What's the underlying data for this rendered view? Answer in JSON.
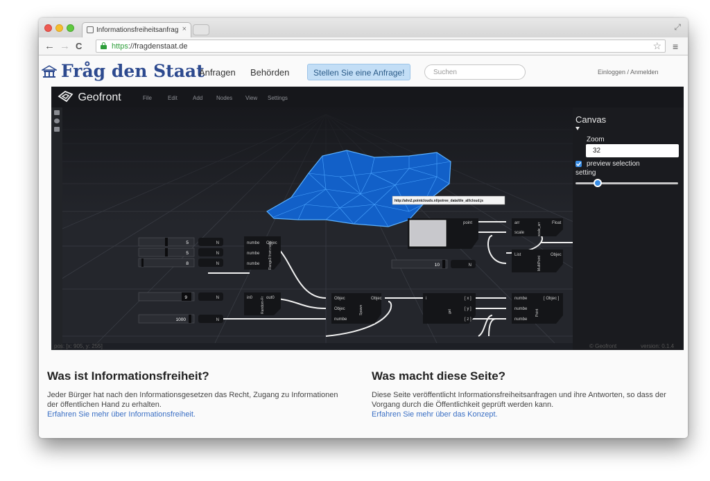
{
  "browser": {
    "tab_title": "Informationsfreiheitsanfrag",
    "tab_close": "×",
    "url_https": "https",
    "url_rest": "://fragdenstaat.de",
    "back": "←",
    "forward": "→",
    "reload": "C",
    "star": "☆",
    "menu": "≡",
    "expand": "⤢"
  },
  "site": {
    "logo": "Fråg den Staat",
    "nav": [
      "Anfragen",
      "Behörden"
    ],
    "cta": "Stellen Sie eine Anfrage!",
    "search_placeholder": "Suchen",
    "login": "Einloggen / Anmelden"
  },
  "app": {
    "name": "Geofront",
    "menu": [
      "File",
      "Edit",
      "Add",
      "Nodes",
      "View",
      "Settings"
    ],
    "tooltip": "http://ahn2.pointclouds.nl/potree_data/tile_all/cloud.js",
    "status_left": "pos: [x: 905, y: 255]",
    "status_right_1": "© Geofront",
    "status_right_2": "version: 0.1.4",
    "properties": {
      "title": "Canvas",
      "zoom_label": "Zoom",
      "zoom_value": "32",
      "preview_label": "preview selection",
      "setting_label": "setting"
    },
    "inputs": [
      "5",
      "5",
      "8",
      "9",
      "1000",
      "10"
    ],
    "node_labels": {
      "n": "N",
      "numbe": "numbe",
      "objec": "Objec",
      "in0": "in0",
      "out0": "out0",
      "point": "point",
      "arr": "arr",
      "scale": "scale",
      "float": "Float",
      "list": "List",
      "x": "[ x ]",
      "y": "[ y ]",
      "z": "[ z ]",
      "objbr": "[ Objec ]",
      "i": "i",
      "range": "Range3 from radii",
      "random": "Random-Fr",
      "spawn": "Spawn",
      "get": "get",
      "point_v": "Point",
      "scale_arr": "scale_arr",
      "multipoint": "MultiPoint"
    }
  },
  "info": {
    "left_title": "Was ist Informationsfreiheit?",
    "left_text": "Jeder Bürger hat nach den Informationsgesetzen das Recht, Zugang zu Informationen der öffentlichen Hand zu erhalten.",
    "left_link": "Erfahren Sie mehr über Informationsfreiheit.",
    "right_title": "Was macht diese Seite?",
    "right_text": "Diese Seite veröffentlicht Informationsfreiheitsanfragen und ihre Antworten, so dass der Vorgang durch die Öffentlichkeit geprüft werden kann.",
    "right_link": "Erfahren Sie mehr über das Konzept."
  },
  "colors": {
    "logo": "#2d4a8f",
    "cta_bg": "#c3def6",
    "mesh": "#1e7ee6",
    "link": "#3a6fc4",
    "app_bg": "#1d1f25",
    "accent": "#3a8ee6"
  }
}
